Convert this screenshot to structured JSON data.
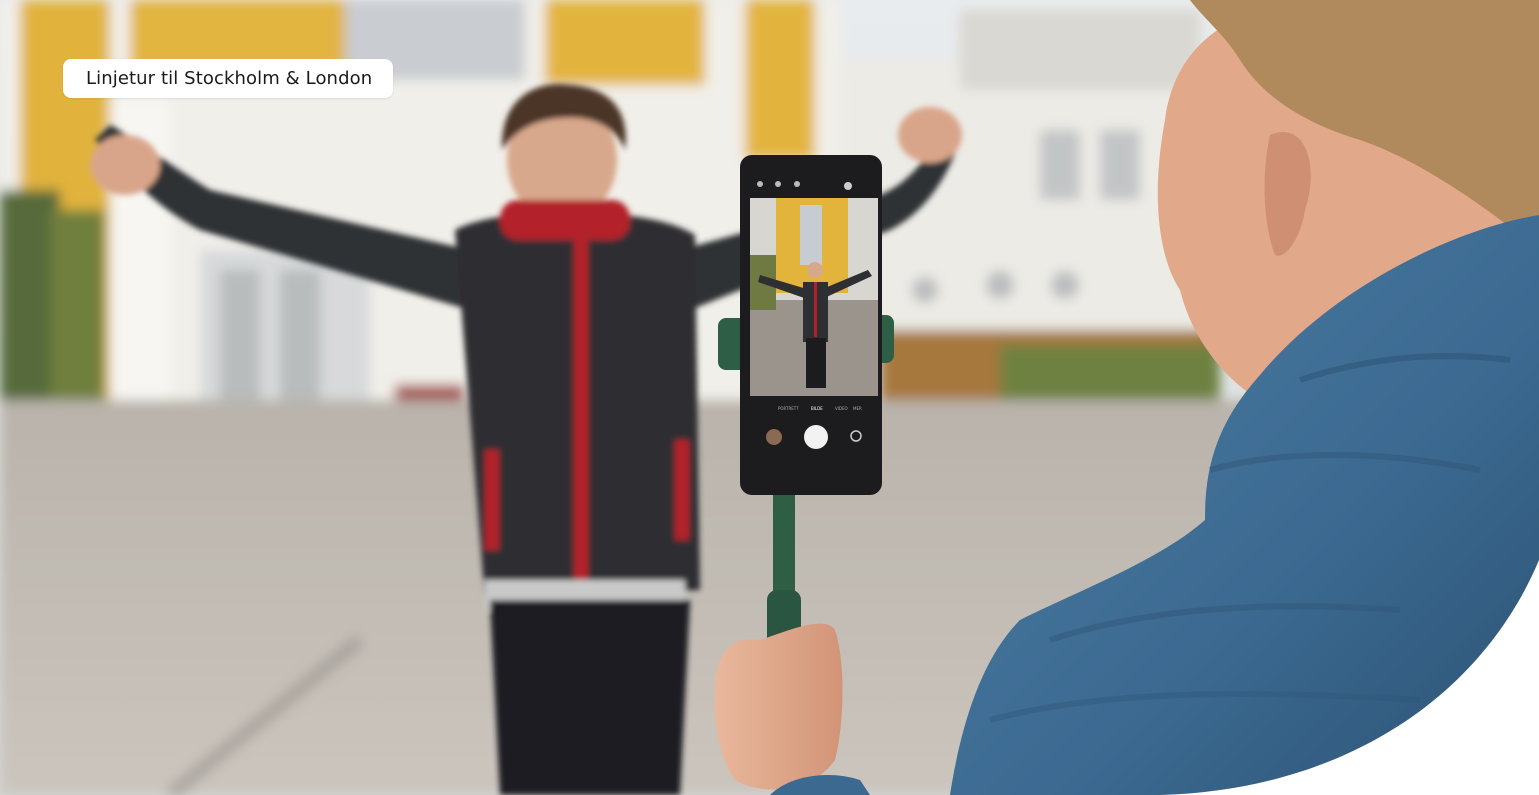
{
  "hero": {
    "tag_label": "Linjetur til Stockholm & London",
    "phone_modes": [
      "PORTRETT",
      "BILDE",
      "VIDEO",
      "MER"
    ]
  },
  "colors": {
    "wall_yellow": "#e3b43c",
    "jacket_dark": "#2e2f33",
    "jacket_red": "#b3202a",
    "jacket_blue": "#3d6a8e",
    "stick_green": "#2d5d46",
    "ground": "#bfb8b0"
  }
}
